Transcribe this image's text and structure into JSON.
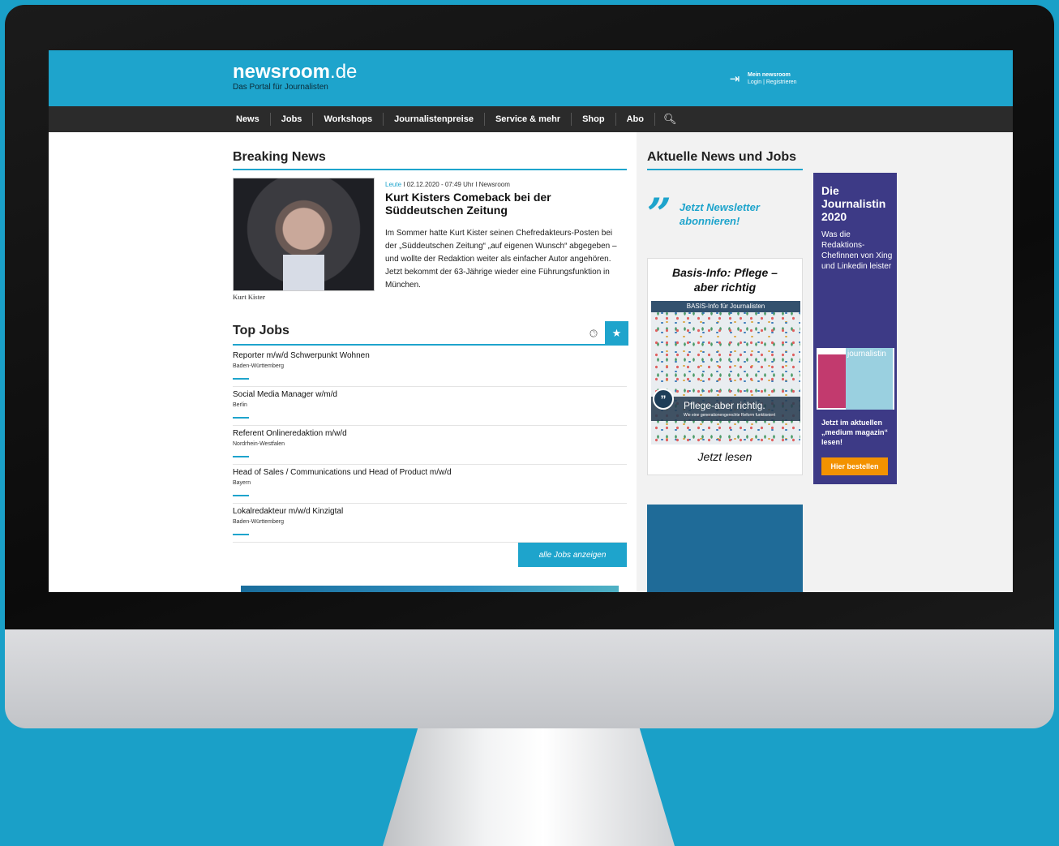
{
  "site": {
    "logo_main": "newsroom",
    "logo_tld": ".de",
    "tagline": "Das Portal für Journalisten",
    "account_title": "Mein newsroom",
    "account_links": "Login | Registrieren"
  },
  "nav": {
    "items": [
      "News",
      "Jobs",
      "Workshops",
      "Journalistenpreise",
      "Service & mehr",
      "Shop",
      "Abo"
    ],
    "search_icon": "search-icon"
  },
  "breaking": {
    "section_title": "Breaking News",
    "category": "Leute",
    "meta": " I 02.12.2020 - 07:49 Uhr I Newsroom",
    "headline": "Kurt Kisters Comeback bei der Süddeutschen Zeitung",
    "teaser": "Im Sommer hatte Kurt Kister seinen Chefredakteurs-Posten bei der „Süddeutschen Zeitung“ „auf eigenen Wunsch“ abgegeben – und wollte der Redaktion weiter als einfacher Autor angehören. Jetzt bekommt der 63-Jährige wieder eine Führungsfunktion in München.",
    "photo_caption": "Kurt Kister"
  },
  "jobs": {
    "section_title": "Top Jobs",
    "items": [
      {
        "title": "Reporter m/w/d Schwerpunkt Wohnen",
        "location": "Baden-Württemberg"
      },
      {
        "title": "Social Media Manager w/m/d",
        "location": "Berlin"
      },
      {
        "title": "Referent Onlineredaktion m/w/d",
        "location": "Nordrhein-Westfalen"
      },
      {
        "title": "Head of Sales / Communications und Head of Product m/w/d",
        "location": "Bayern"
      },
      {
        "title": "Lokalredakteur m/w/d Kinzigtal",
        "location": "Baden-Württemberg"
      }
    ],
    "all_jobs_button": "alle Jobs anzeigen",
    "icons": [
      "clock-icon",
      "star-icon"
    ]
  },
  "sidebar": {
    "section_title": "Aktuelle News und Jobs",
    "newsletter_line1": "Jetzt Newsletter",
    "newsletter_line2": "abonnieren!",
    "basis_title_1": "Basis-Info: Pflege –",
    "basis_title_2": "aber richtig",
    "basis_band": "BASIS-Info für Journalisten",
    "basis_banner_title": "Pflege-aber richtig.",
    "basis_banner_sub": "Wie eine generationengerechte Reform funktioniert",
    "basis_cta": "Jetzt lesen"
  },
  "ad": {
    "headline_1": "Die",
    "headline_2": "Journalistin",
    "headline_3": "2020",
    "text": "Was die Redaktions-Chefinnen von Xing und Linkedin leister",
    "magazine_label": "journalistin",
    "text2": "Jetzt im aktuellen „medium magazin“ lesen!",
    "button": "Hier bestellen"
  },
  "colors": {
    "accent": "#1ea4cc",
    "nav_bg": "#2b2b2b",
    "ad_bg": "#3d3a86",
    "ad_button": "#f39200"
  }
}
